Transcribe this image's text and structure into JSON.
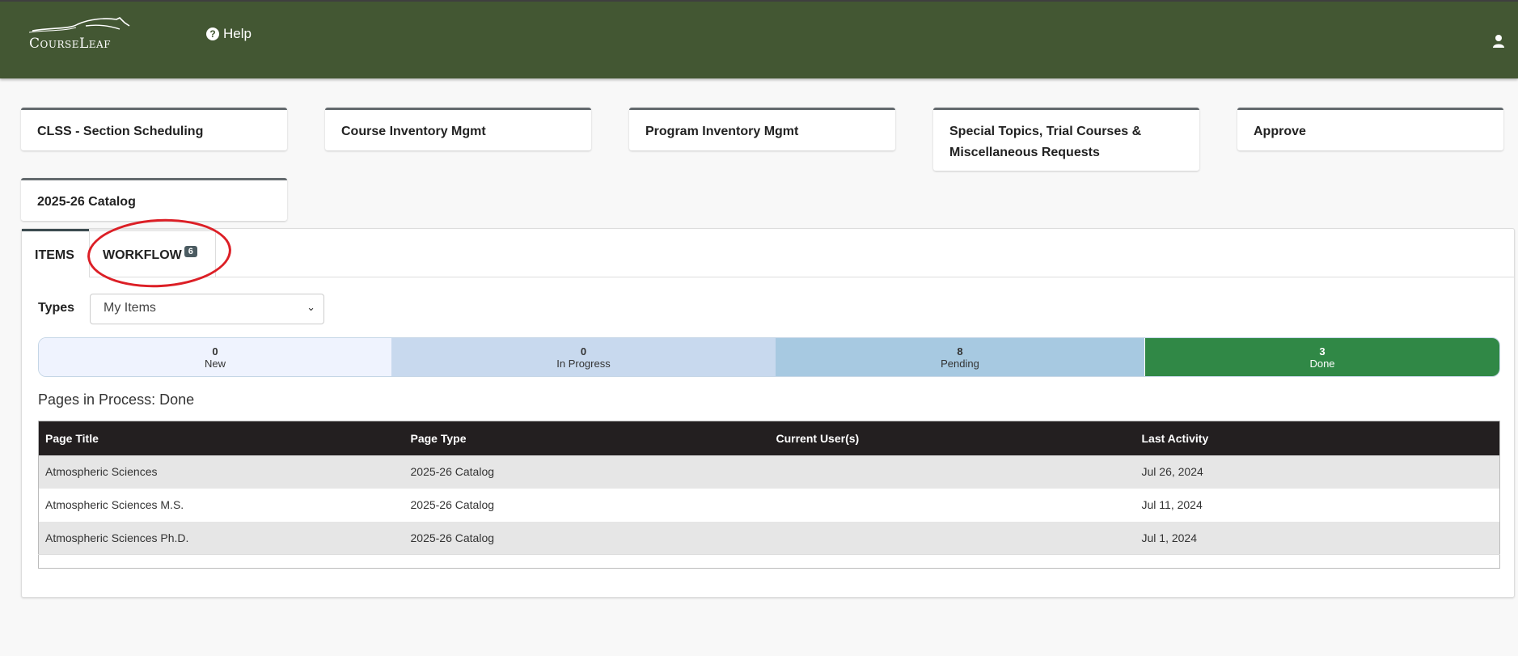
{
  "header": {
    "logo_text": "CourseLeaf",
    "help_label": "Help",
    "icons": {
      "help": "question-circle-icon",
      "user": "user-icon"
    },
    "bg_color": "#435733"
  },
  "cards": [
    {
      "label": "CLSS - Section Scheduling"
    },
    {
      "label": "Course Inventory Mgmt"
    },
    {
      "label": "Program Inventory Mgmt"
    },
    {
      "label": "Special Topics, Trial Courses & Miscellaneous Requests"
    },
    {
      "label": "Approve"
    },
    {
      "label": "2025-26 Catalog"
    }
  ],
  "tabs": {
    "items_label": "ITEMS",
    "workflow_label": "WORKFLOW",
    "workflow_badge": "6",
    "active": "ITEMS"
  },
  "filter": {
    "types_label": "Types",
    "types_selected": "My Items"
  },
  "status_bar": [
    {
      "count": "0",
      "label": "New",
      "color": "#eff3fe"
    },
    {
      "count": "0",
      "label": "In Progress",
      "color": "#c8d9ee"
    },
    {
      "count": "8",
      "label": "Pending",
      "color": "#a7c9e1"
    },
    {
      "count": "3",
      "label": "Done",
      "color": "#308846"
    }
  ],
  "section_title": "Pages in Process: Done",
  "table": {
    "columns": [
      "Page Title",
      "Page Type",
      "Current User(s)",
      "Last Activity"
    ],
    "rows": [
      [
        "Atmospheric Sciences",
        "2025-26 Catalog",
        "",
        "Jul 26, 2024"
      ],
      [
        "Atmospheric Sciences M.S.",
        "2025-26 Catalog",
        "",
        "Jul 11, 2024"
      ],
      [
        "Atmospheric Sciences Ph.D.",
        "2025-26 Catalog",
        "",
        "Jul 1, 2024"
      ]
    ]
  },
  "annotation": {
    "type": "red-ellipse",
    "target": "WORKFLOW tab",
    "color": "#dc1f26"
  }
}
